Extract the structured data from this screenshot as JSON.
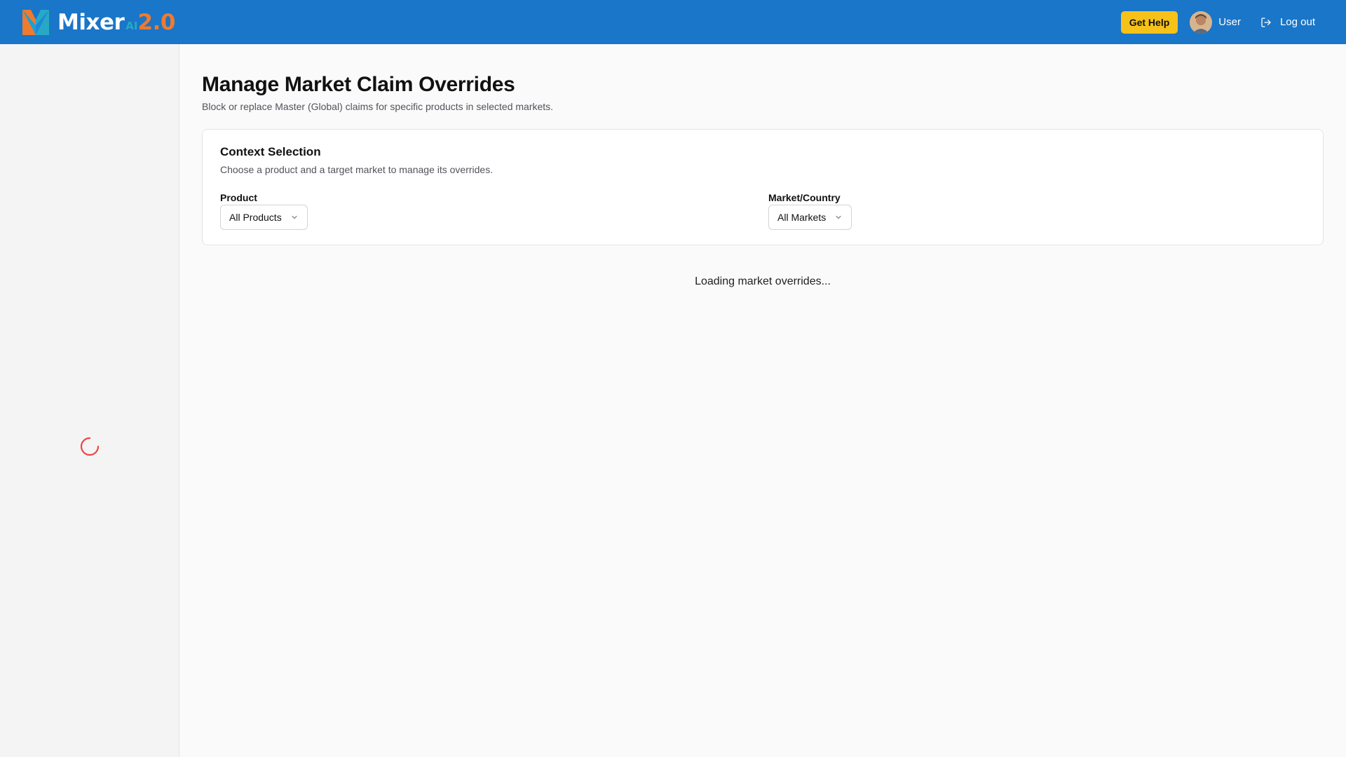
{
  "header": {
    "brand_name": "Mixer",
    "brand_ai": "AI",
    "brand_version": "2.0",
    "help_label": "Get Help",
    "user_label": "User",
    "logout_label": "Log out"
  },
  "page": {
    "title": "Manage Market Claim Overrides",
    "subtitle": "Block or replace Master (Global) claims for specific products in selected markets."
  },
  "context": {
    "title": "Context Selection",
    "subtitle": "Choose a product and a target market to manage its overrides.",
    "product_label": "Product",
    "product_value": "All Products",
    "market_label": "Market/Country",
    "market_value": "All Markets"
  },
  "status": {
    "loading_text": "Loading market overrides..."
  },
  "colors": {
    "header_bg": "#1976c8",
    "help_button": "#f6c21a",
    "spinner": "#ef4444",
    "brand_orange": "#f07a2e",
    "brand_teal": "#27a9c6"
  },
  "icons": {
    "logo": "mixer-logo-icon",
    "avatar": "user-avatar",
    "logout": "logout-icon",
    "dropdown": "chevron-down-icon",
    "spinner": "loading-spinner-icon"
  }
}
